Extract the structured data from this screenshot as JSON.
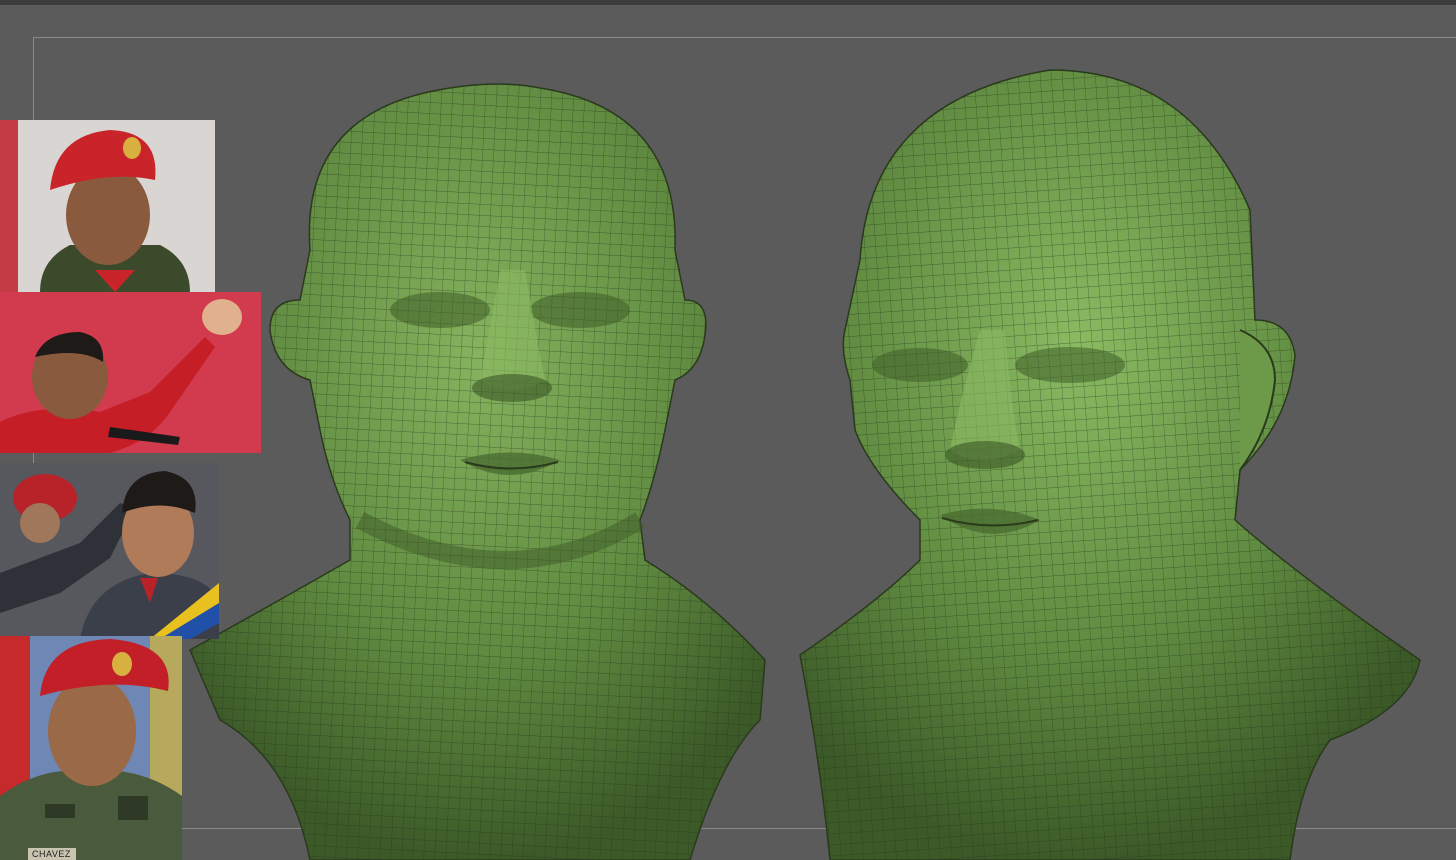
{
  "viewport": {
    "background_color": "#5b5b5b",
    "frame_color": "#8a8a8a",
    "mesh_color": "#6e9a4a",
    "mesh_wire_color": "#2c3a1e"
  },
  "reference_panel": {
    "photos": [
      {
        "name": "ref-photo-red-beret-profile",
        "dominant_color": "#c8242a"
      },
      {
        "name": "ref-photo-raised-fist-speech",
        "dominant_color": "#d23a4e"
      },
      {
        "name": "ref-photo-military-salute",
        "dominant_color": "#3b3f4a"
      },
      {
        "name": "ref-photo-uniform-portrait",
        "dominant_color": "#c21f28",
        "name_tag": "CHAVEZ"
      }
    ]
  },
  "renders": [
    {
      "name": "head-mesh-front-view"
    },
    {
      "name": "head-mesh-three-quarter-view"
    }
  ]
}
